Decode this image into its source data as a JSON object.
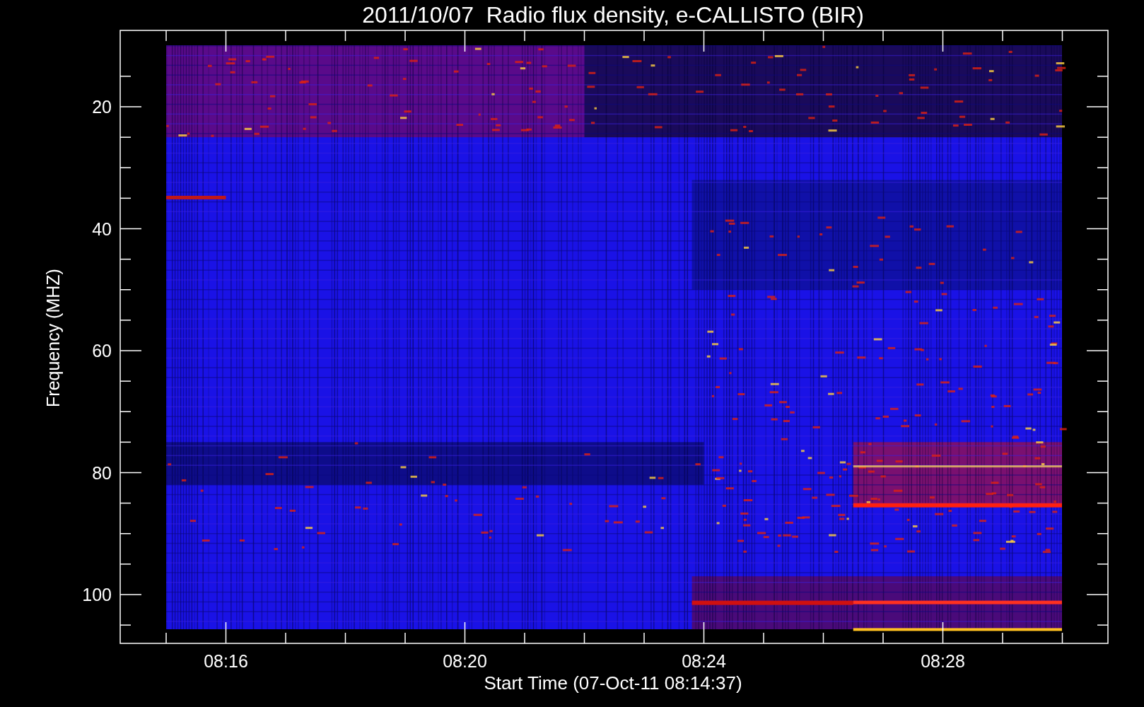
{
  "title": "2011/10/07  Radio flux density, e-CALLISTO (BIR)",
  "y_axis": {
    "label": "Frequency (MHZ)",
    "ticks": [
      "20",
      "40",
      "60",
      "80",
      "100"
    ]
  },
  "x_axis": {
    "label": "Start Time (07-Oct-11 08:14:37)",
    "ticks": [
      "08:16",
      "08:20",
      "08:24",
      "08:28"
    ]
  }
}
